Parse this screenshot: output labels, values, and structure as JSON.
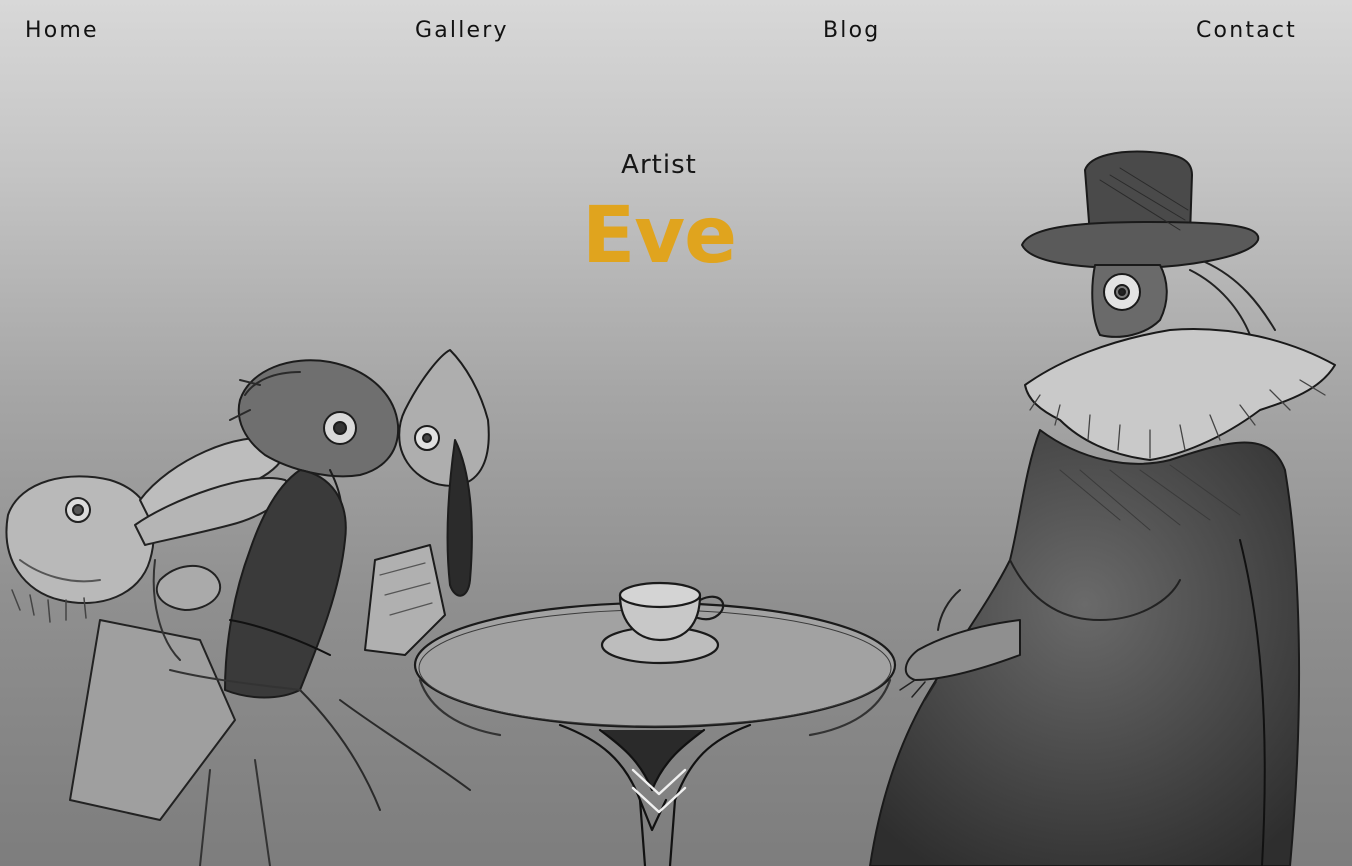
{
  "nav": {
    "home": "Home",
    "gallery": "Gallery",
    "blog": "Blog",
    "contact": "Contact"
  },
  "hero": {
    "subtitle": "Artist",
    "name": "Eve",
    "name_color": "#e0a41e"
  },
  "icons": {
    "scroll": "double-chevron-down-icon"
  }
}
